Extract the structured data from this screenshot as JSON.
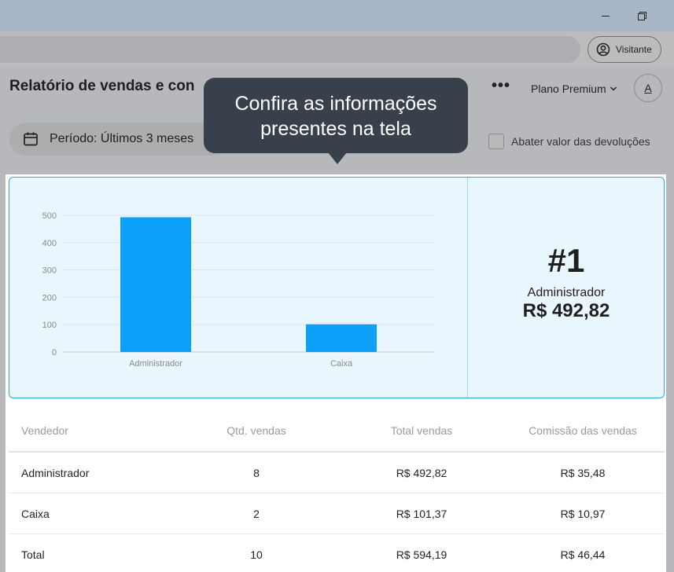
{
  "browser": {
    "guest_label": "Visitante",
    "minimize_icon": "minimize-icon",
    "restore_icon": "restore-icon",
    "profile_icon": "user-circle-icon"
  },
  "header": {
    "title": "Relatório de vendas e con",
    "more_label": "•••",
    "plan_label": "Plano Premium",
    "avatar_letter": "A"
  },
  "filters": {
    "period_label": "Período: Últimos 3 meses",
    "calendar_icon": "calendar-icon",
    "deduct_label": "Abater valor das devoluções",
    "deduct_checked": false
  },
  "tooltip": {
    "line1": "Confira as informações",
    "line2": "presentes na tela"
  },
  "colors": {
    "bar": "#0da0f8",
    "card_bg": "#e9f6fd",
    "card_border": "#29a9de",
    "tooltip_bg": "#38404b"
  },
  "chart_data": {
    "type": "bar",
    "categories": [
      "Administrador",
      "Caixa"
    ],
    "values": [
      492.82,
      101.37
    ],
    "yticks": [
      0,
      100,
      200,
      300,
      400,
      500
    ],
    "ylim": [
      0,
      500
    ],
    "grid": true
  },
  "top_seller": {
    "rank": "#1",
    "name": "Administrador",
    "value": "R$ 492,82"
  },
  "table": {
    "headers": [
      "Vendedor",
      "Qtd. vendas",
      "Total vendas",
      "Comissão das vendas"
    ],
    "rows": [
      [
        "Administrador",
        "8",
        "R$ 492,82",
        "R$ 35,48"
      ],
      [
        "Caixa",
        "2",
        "R$ 101,37",
        "R$ 10,97"
      ],
      [
        "Total",
        "10",
        "R$ 594,19",
        "R$ 46,44"
      ]
    ]
  }
}
